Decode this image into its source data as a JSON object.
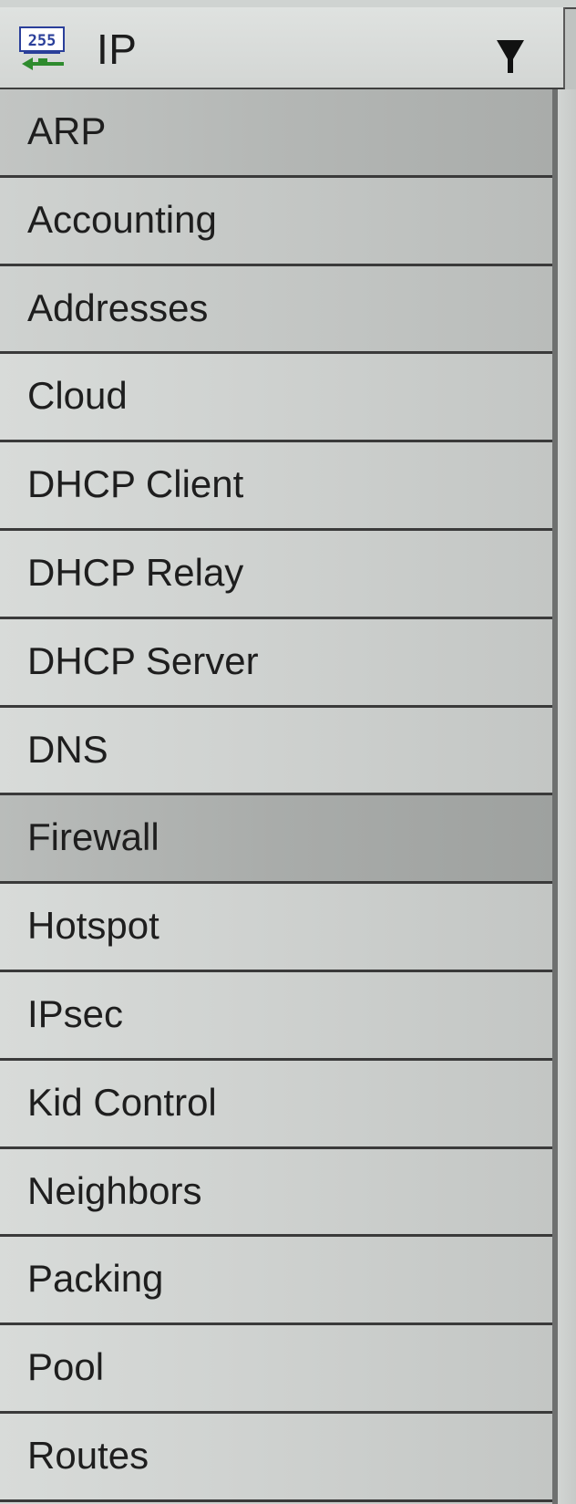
{
  "header": {
    "title": "IP",
    "icon": "network-ip-icon",
    "icon_text": "255",
    "dropdown_icon": "dropdown-arrow-icon"
  },
  "menu": {
    "items": [
      {
        "label": "ARP"
      },
      {
        "label": "Accounting"
      },
      {
        "label": "Addresses"
      },
      {
        "label": "Cloud"
      },
      {
        "label": "DHCP Client"
      },
      {
        "label": "DHCP Relay"
      },
      {
        "label": "DHCP Server"
      },
      {
        "label": "DNS"
      },
      {
        "label": "Firewall",
        "highlighted": true
      },
      {
        "label": "Hotspot"
      },
      {
        "label": "IPsec"
      },
      {
        "label": "Kid Control"
      },
      {
        "label": "Neighbors"
      },
      {
        "label": "Packing"
      },
      {
        "label": "Pool"
      },
      {
        "label": "Routes"
      }
    ]
  },
  "colors": {
    "text": "#1e1e1e",
    "divider": "#3a3a3a",
    "icon_green": "#2e8b2e",
    "icon_blue": "#2a3f9a"
  }
}
